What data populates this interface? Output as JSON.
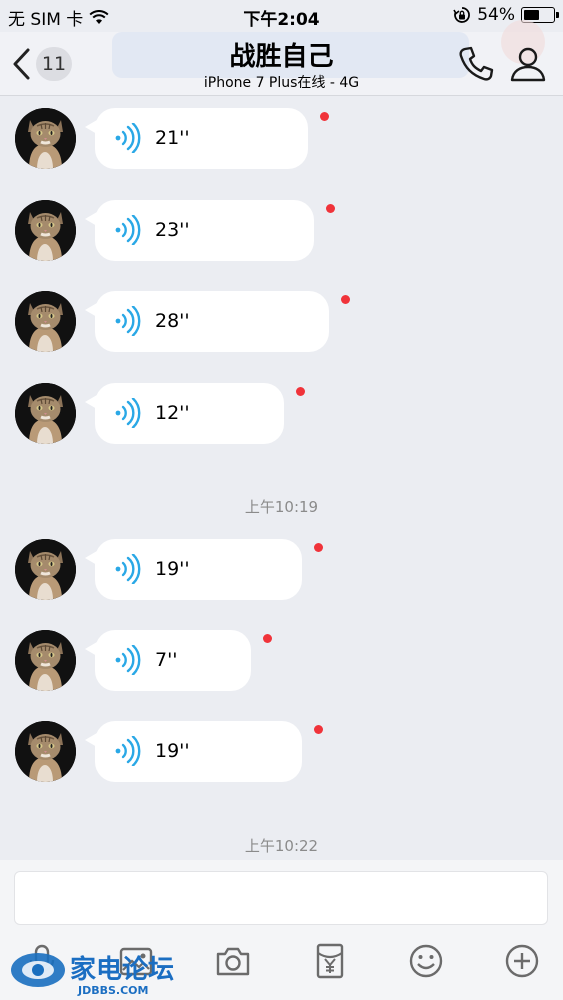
{
  "status_bar": {
    "carrier": "无 SIM 卡",
    "time": "下午2:04",
    "battery": "54%",
    "battery_level": 0.54
  },
  "header": {
    "unread_count": "11",
    "title": "战胜自己",
    "subtitle": "iPhone 7 Plus在线 - 4G"
  },
  "messages": [
    {
      "duration": "21''",
      "unread": true
    },
    {
      "duration": "23''",
      "unread": true
    },
    {
      "duration": "28''",
      "unread": true
    },
    {
      "duration": "12''",
      "unread": true
    },
    {
      "duration": "19''",
      "unread": true
    },
    {
      "duration": "7''",
      "unread": true
    },
    {
      "duration": "19''",
      "unread": true
    }
  ],
  "timestamps": [
    "上午10:19",
    "上午10:22"
  ],
  "watermark": {
    "name": "家电论坛",
    "domain": "JDBBS.COM"
  },
  "colors": {
    "voice_icon": "#2aa8e6",
    "unread_dot": "#f0333a",
    "background": "#ebedf2"
  },
  "icons": [
    "back-icon",
    "phone-icon",
    "profile-icon",
    "voice-wave-icon",
    "microphone-icon",
    "image-icon",
    "camera-icon",
    "red-packet-icon",
    "emoji-icon",
    "plus-icon"
  ]
}
